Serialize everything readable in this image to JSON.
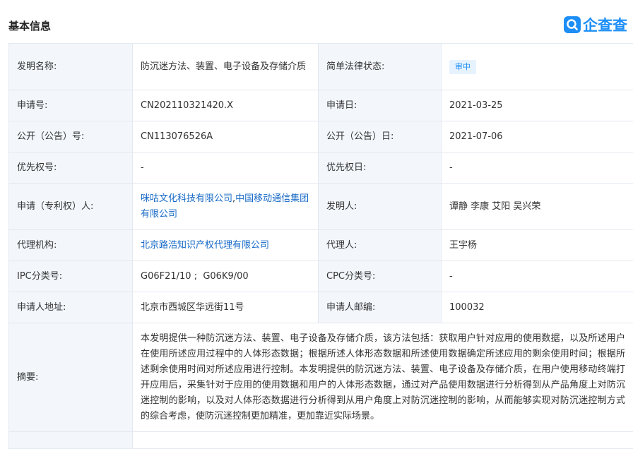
{
  "header": {
    "title": "基本信息",
    "logo_text": "企查查"
  },
  "labels": {
    "invention_name": "发明名称:",
    "legal_status": "简单法律状态:",
    "app_no": "申请号:",
    "app_date": "申请日:",
    "pub_no": "公开（公告）号:",
    "pub_date": "公开（公告）日:",
    "priority_no": "优先权号:",
    "priority_date": "优先权日:",
    "applicant": "申请（专利权）人:",
    "inventor": "发明人:",
    "agency": "代理机构:",
    "agent": "代理人:",
    "ipc": "IPC分类号:",
    "cpc": "CPC分类号:",
    "address": "申请人地址:",
    "postcode": "申请人邮编:",
    "abstract": "摘要:"
  },
  "values": {
    "invention_name": "防沉迷方法、装置、电子设备及存储介质",
    "legal_status": "审中",
    "app_no": "CN202110321420.X",
    "app_date": "2021-03-25",
    "pub_no": "CN113076526A",
    "pub_date": "2021-07-06",
    "priority_no": "-",
    "priority_date": "-",
    "applicant_1": "咪咕文化科技有限公司",
    "applicant_sep": ",",
    "applicant_2": "中国移动通信集团有限公司",
    "inventor": "谭静 李康 艾阳 吴兴荣",
    "agency": "北京路浩知识产权代理有限公司",
    "agent": "王宇杨",
    "ipc": "G06F21/10 ;  G06K9/00",
    "cpc": "-",
    "address": "北京市西城区华远街11号",
    "postcode": "100032",
    "abstract": "本发明提供一种防沉迷方法、装置、电子设备及存储介质，该方法包括：获取用户针对应用的使用数据，以及所述用户在使用所述应用过程中的人体形态数据；根据所述人体形态数据和所述使用数据确定所述应用的剩余使用时间；根据所述剩余使用时间对所述应用进行控制。本发明提供的防沉迷方法、装置、电子设备及存储介质，在用户使用移动终端打开应用后，采集针对于应用的使用数据和用户的人体形态数据，通过对产品使用数据进行分析得到从产品角度上对防沉迷控制的影响，以及对人体形态数据进行分析得到从用户角度上对防沉迷控制的影响，从而能够实现对防沉迷控制方式的综合考虑，使防沉迷控制更加精准，更加靠近实际场景。"
  },
  "colors": {
    "label_bg": "#f3f7fc",
    "border": "#e4e8ef",
    "link": "#1568c6",
    "brand": "#1c8ef6"
  }
}
